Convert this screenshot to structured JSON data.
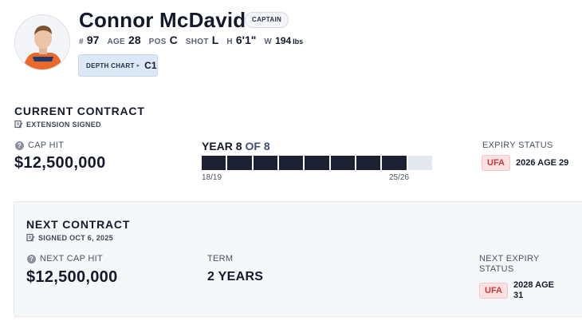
{
  "player": {
    "name": "Connor McDavid",
    "badge": "CAPTAIN",
    "number_label": "#",
    "number": "97",
    "age_label": "AGE",
    "age": "28",
    "pos_label": "POS",
    "pos": "C",
    "shot_label": "SHOT",
    "shot": "L",
    "height_label": "H",
    "height": "6'1\"",
    "weight_label": "W",
    "weight": "194",
    "weight_unit": "lbs",
    "depth_chart_label": "DEPTH CHART",
    "depth_chart_value": "C1"
  },
  "current_contract": {
    "title": "CURRENT CONTRACT",
    "note": "EXTENSION SIGNED",
    "cap_hit_label": "CAP HIT",
    "cap_hit": "$12,500,000",
    "year_label": "YEAR",
    "year_current": "8",
    "year_of": "OF",
    "year_total": "8",
    "progress_filled": 8,
    "progress_total": 9,
    "start_season": "18/19",
    "end_season": "25/26",
    "expiry_label": "EXPIRY STATUS",
    "expiry_badge": "UFA",
    "expiry_text": "2026 AGE 29"
  },
  "next_contract": {
    "title": "NEXT CONTRACT",
    "note": "SIGNED OCT 6, 2025",
    "cap_hit_label": "NEXT CAP HIT",
    "cap_hit": "$12,500,000",
    "term_label": "TERM",
    "term": "2 YEARS",
    "expiry_label_line1": "NEXT EXPIRY",
    "expiry_label_line2": "STATUS",
    "expiry_badge": "UFA",
    "expiry_text_line1": "2028 AGE",
    "expiry_text_line2": "31"
  },
  "icons": {
    "help": "question-circle-icon",
    "note": "signed-document-icon",
    "chevron": "chevron-right-icon"
  },
  "colors": {
    "progress_filled": "#1c2234",
    "progress_empty": "#e3e8ef",
    "ufa_bg": "#fbe1e1",
    "ufa_text": "#c43a3a",
    "depth_bg": "#dde8f7"
  }
}
